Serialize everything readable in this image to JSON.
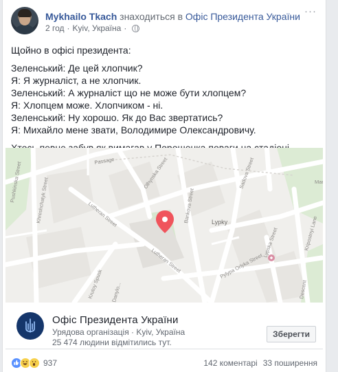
{
  "post": {
    "author": "Mykhailo Tkach",
    "action": "знаходиться в",
    "place_link": "Офіс Президента України",
    "time": "2 год",
    "location": "Kyiv, Україна",
    "lines": [
      "Щойно в офісі президента:",
      "",
      "Зеленський: Де цей хлопчик?",
      "Я: Я журналіст, а не хлопчик.",
      "Зеленський: А журналіст що не може бути хлопцем?",
      "Я: Хлопцем може. Хлопчиком - ні.",
      "Зеленський: Ну хорошо. Як до Вас звертатись?",
      "Я: Михайло мене звати, Володимире Олександровичу.",
      "",
      "Хтось певне забув як вимагав у Порошенка поваги на стадіоні."
    ]
  },
  "map": {
    "labels": {
      "passage": "Passage",
      "olhynska": "Olhynska Street",
      "sadova": "Sadova Street",
      "bankova": "Bankova Street",
      "lutheran_top": "Lutheran Street",
      "lutheran_bottom": "Lutheran Street",
      "khreshchatyk": "Khreshchatyk Street",
      "pushkinska": "Pushkinska Street",
      "lypky": "Lypky",
      "lypska": "Lypska Street",
      "pylypa": "Pylypa Orlyka Street",
      "kripostny": "Kripostnyi Lane",
      "krutoi": "Krutoy Spusk",
      "danylo": "Danylo...",
      "descent": "Descent",
      "mar": "Mar"
    }
  },
  "place": {
    "name": "Офіс Президента України",
    "category": "Урядова організація",
    "city": "Kyiv, Україна",
    "checkins": "25 474 людини відмітились тут.",
    "save_label": "Зберегти"
  },
  "footer": {
    "reaction_count": "937",
    "comments": "142 коментарі",
    "shares": "33 поширення"
  },
  "colors": {
    "link": "#365899",
    "pin": "#f0545c",
    "place_logo_bg": "#15366b"
  }
}
